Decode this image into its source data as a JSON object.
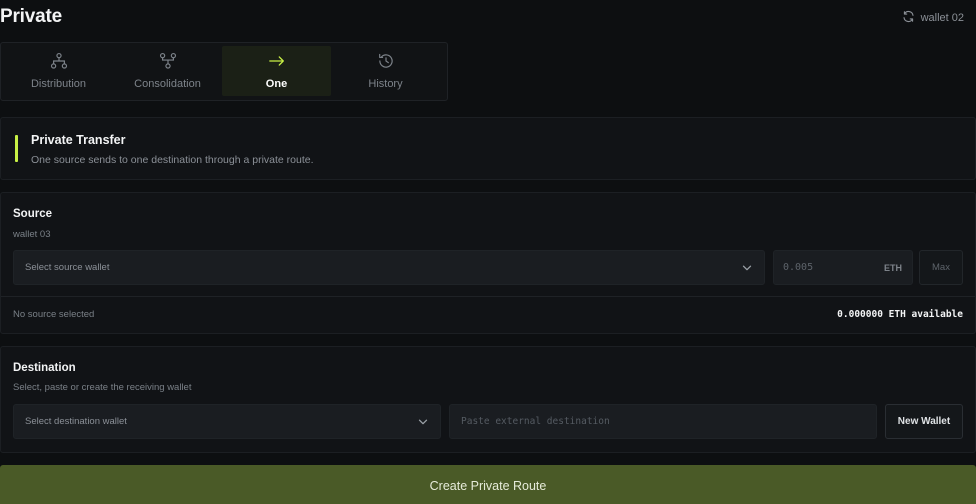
{
  "header": {
    "title": "Private",
    "wallet_label": "wallet 02",
    "wallet_icon": "refresh-icon"
  },
  "tabs": [
    {
      "label": "Distribution",
      "icon": "distribution-icon",
      "active": false
    },
    {
      "label": "Consolidation",
      "icon": "consolidation-icon",
      "active": false
    },
    {
      "label": "One",
      "icon": "arrow-right-icon",
      "active": true
    },
    {
      "label": "History",
      "icon": "history-icon",
      "active": false
    }
  ],
  "info": {
    "title": "Private Transfer",
    "description": "One source sends to one destination through a private route."
  },
  "source": {
    "title": "Source",
    "subtitle": "wallet 03",
    "select_placeholder": "Select source wallet",
    "amount_placeholder": "0.005",
    "amount_unit": "ETH",
    "max_label": "Max",
    "status_text": "No source selected",
    "available_text": "0.000000 ETH available"
  },
  "destination": {
    "title": "Destination",
    "subtitle": "Select, paste or create the receiving wallet",
    "select_placeholder": "Select destination wallet",
    "external_placeholder": "Paste external destination",
    "new_wallet_label": "New Wallet"
  },
  "actions": {
    "create_label": "Create Private Route"
  },
  "colors": {
    "accent": "#c8f045",
    "primary_button": "#4a5a27",
    "background": "#0d0f11",
    "panel": "#111316"
  }
}
